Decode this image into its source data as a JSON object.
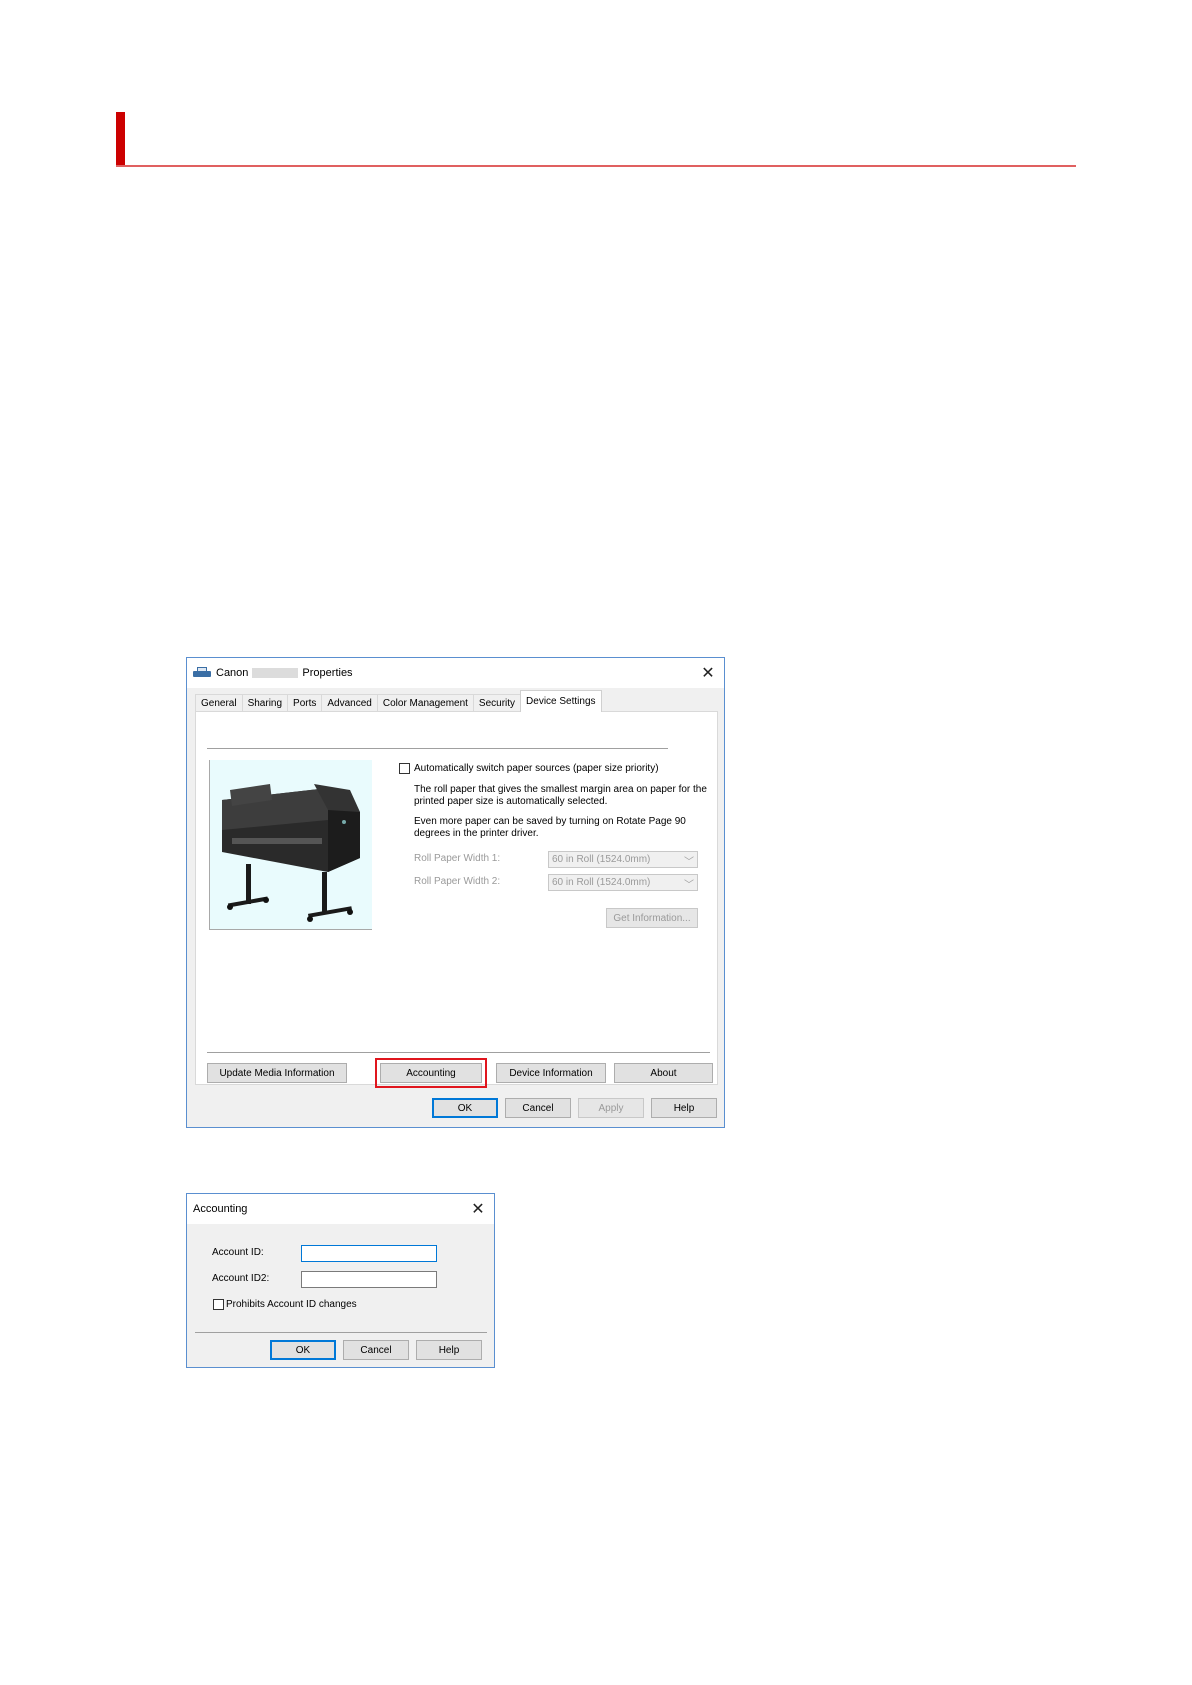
{
  "page": {
    "heading": ""
  },
  "properties_dialog": {
    "title_prefix": "Canon",
    "title_suffix": "Properties",
    "close_glyph": "✕",
    "tabs": [
      "General",
      "Sharing",
      "Ports",
      "Advanced",
      "Color Management",
      "Security",
      "Device Settings"
    ],
    "active_tab": "Device Settings",
    "auto_switch_label": "Automatically switch paper sources (paper size priority)",
    "auto_switch_checked": false,
    "desc_line1": "The roll paper that gives the smallest margin area on paper for the",
    "desc_line2": "printed paper size is automatically selected.",
    "desc_line3": "Even more paper can be saved by turning on Rotate Page 90",
    "desc_line4": "degrees in the printer driver.",
    "roll_width_1_label": "Roll Paper Width 1:",
    "roll_width_1_value": "60 in Roll (1524.0mm)",
    "roll_width_2_label": "Roll Paper Width 2:",
    "roll_width_2_value": "60 in Roll (1524.0mm)",
    "get_info_label": "Get Information...",
    "update_media_label": "Update Media Information",
    "accounting_label": "Accounting",
    "device_info_label": "Device Information",
    "about_label": "About",
    "ok_label": "OK",
    "cancel_label": "Cancel",
    "apply_label": "Apply",
    "help_label": "Help",
    "highlight_color": "#e0161e"
  },
  "accounting_dialog": {
    "title": "Accounting",
    "close_glyph": "✕",
    "account_id_label": "Account ID:",
    "account_id_value": "",
    "account_id2_label": "Account ID2:",
    "account_id2_value": "",
    "prohibit_label": "Prohibits Account ID changes",
    "prohibit_checked": false,
    "ok_label": "OK",
    "cancel_label": "Cancel",
    "help_label": "Help"
  },
  "colors": {
    "accent_red": "#cc0000",
    "window_border": "#5a8fd0",
    "focus_blue": "#0078d7"
  },
  "icons": [
    "printer-icon",
    "close-icon",
    "dropdown-arrow-icon",
    "printer-product-image"
  ]
}
